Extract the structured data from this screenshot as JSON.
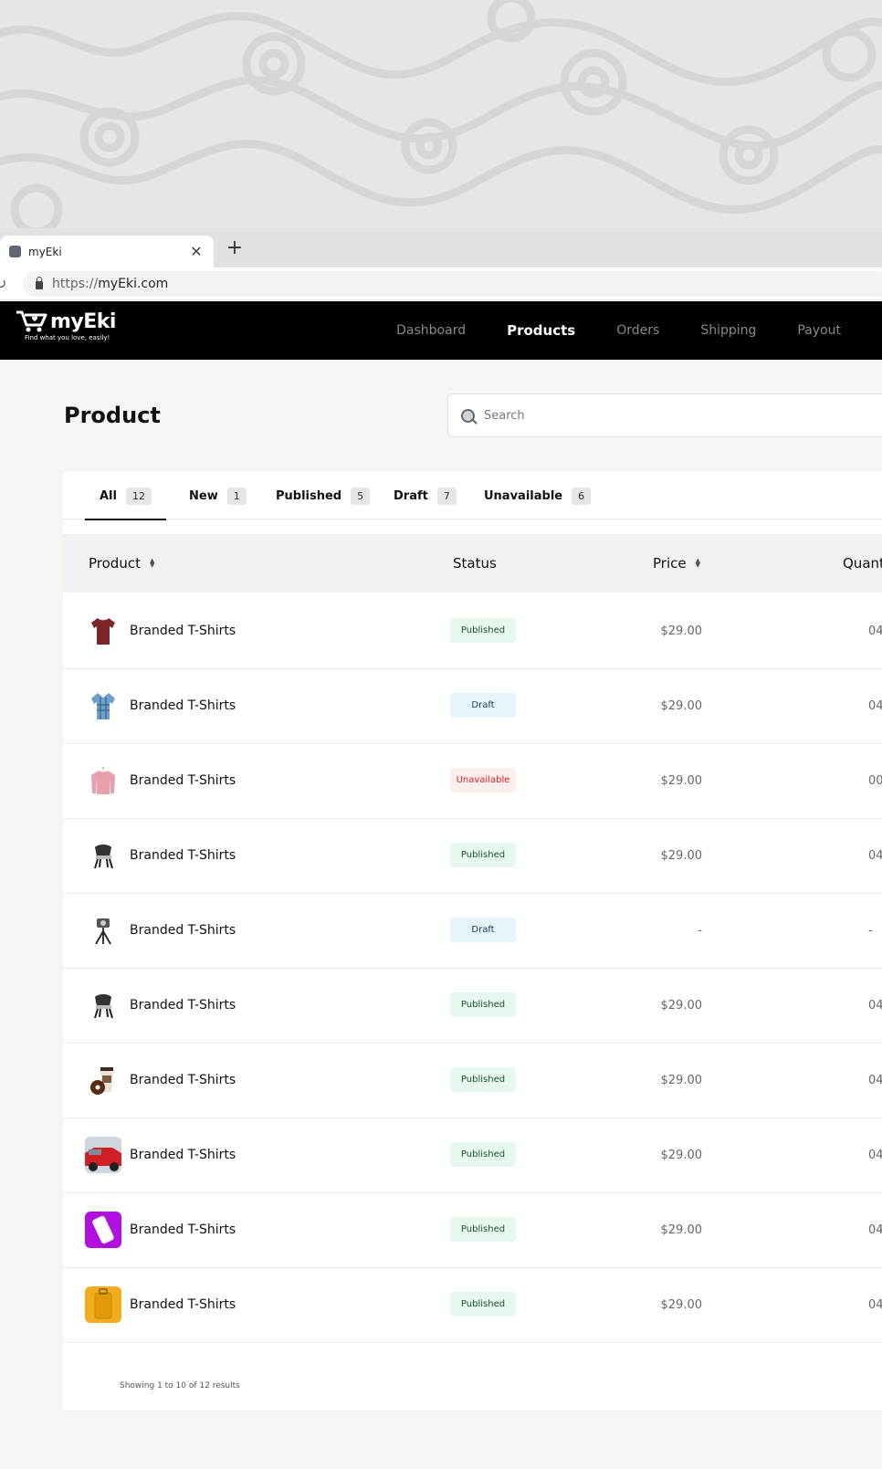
{
  "browser": {
    "tab_title": "myEki",
    "url_protocol": "https://",
    "url_host": "myEki.com"
  },
  "navbar": {
    "logo_name": "myEki",
    "tagline": "Find what you love, easily!",
    "links": [
      {
        "label": "Dashboard",
        "active": false
      },
      {
        "label": "Products",
        "active": true
      },
      {
        "label": "Orders",
        "active": false
      },
      {
        "label": "Shipping",
        "active": false
      },
      {
        "label": "Payout",
        "active": false
      }
    ]
  },
  "page": {
    "title": "Product",
    "search_placeholder": "Search"
  },
  "filters": [
    {
      "label": "All",
      "count": "12",
      "active": true
    },
    {
      "label": "New",
      "count": "1",
      "active": false
    },
    {
      "label": "Published",
      "count": "5",
      "active": false
    },
    {
      "label": "Draft",
      "count": "7",
      "active": false
    },
    {
      "label": "Unavailable",
      "count": "6",
      "active": false
    }
  ],
  "table": {
    "columns": [
      "Product",
      "Status",
      "Price",
      "Quant"
    ],
    "rows": [
      {
        "name": "Branded T-Shirts",
        "status": "Published",
        "price": "$29.00",
        "qty": "04",
        "icon": "maroon-tshirt-icon"
      },
      {
        "name": "Branded T-Shirts",
        "status": "Draft",
        "price": "$29.00",
        "qty": "04",
        "icon": "plaid-shirt-icon"
      },
      {
        "name": "Branded T-Shirts",
        "status": "Unavailable",
        "price": "$29.00",
        "qty": "00",
        "icon": "pink-sweater-icon"
      },
      {
        "name": "Branded T-Shirts",
        "status": "Published",
        "price": "$29.00",
        "qty": "04",
        "icon": "chair-icon"
      },
      {
        "name": "Branded T-Shirts",
        "status": "Draft",
        "price": "-",
        "qty": "-",
        "icon": "camera-tripod-icon"
      },
      {
        "name": "Branded T-Shirts",
        "status": "Published",
        "price": "$29.00",
        "qty": "04",
        "icon": "chair-icon"
      },
      {
        "name": "Branded T-Shirts",
        "status": "Published",
        "price": "$29.00",
        "qty": "04",
        "icon": "coffee-donut-icon"
      },
      {
        "name": "Branded T-Shirts",
        "status": "Published",
        "price": "$29.00",
        "qty": "04",
        "icon": "red-car-icon"
      },
      {
        "name": "Branded T-Shirts",
        "status": "Published",
        "price": "$29.00",
        "qty": "04",
        "icon": "phone-icon"
      },
      {
        "name": "Branded T-Shirts",
        "status": "Published",
        "price": "$29.00",
        "qty": "04",
        "icon": "yellow-suitcase-icon"
      }
    ]
  },
  "footer": {
    "showing": "Showing 1 to 10 of 12 results"
  },
  "colors": {
    "navbar_bg": "#000000",
    "published_bg": "#e7f8ee",
    "draft_bg": "#e5f3fb",
    "unavailable_bg": "#fdeeee",
    "unavailable_text": "#d92020"
  }
}
